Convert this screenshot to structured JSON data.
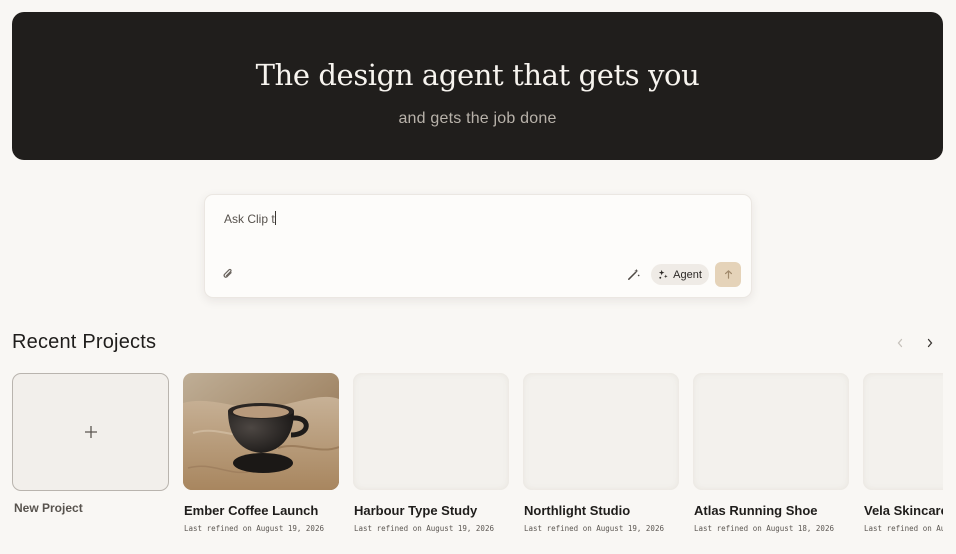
{
  "hero": {
    "title": "The design agent that gets you",
    "subtitle": "and gets the job done"
  },
  "prompt": {
    "typed_text": "Ask Clip t",
    "attach_icon": "paperclip-icon",
    "magic_icon": "magic-wand-icon",
    "agent_label": "Agent",
    "agent_icon": "sparkles-icon",
    "send_icon": "arrow-up-icon",
    "send_color": "#e5d3b9"
  },
  "recent": {
    "title": "Recent Projects",
    "prev_icon": "chevron-left-icon",
    "next_icon": "chevron-right-icon",
    "new_project_label": "New Project",
    "new_project_icon": "plus-icon",
    "projects": [
      {
        "name": "Ember Coffee Launch",
        "date": "Last refined on August 19, 2026",
        "thumbnail": "coffee-cup-photo"
      },
      {
        "name": "Harbour Type Study",
        "date": "Last refined on August 19, 2026",
        "thumbnail": "blank"
      },
      {
        "name": "Northlight Studio",
        "date": "Last refined on August 19, 2026",
        "thumbnail": "blank"
      },
      {
        "name": "Atlas Running Shoe",
        "date": "Last refined on August 18, 2026",
        "thumbnail": "blank"
      },
      {
        "name": "Vela Skincare",
        "date": "Last refined on Aug",
        "thumbnail": "blank"
      }
    ]
  },
  "colors": {
    "background": "#f9f7f4",
    "hero_background": "#201e1c",
    "accent": "#e5d3b9"
  }
}
